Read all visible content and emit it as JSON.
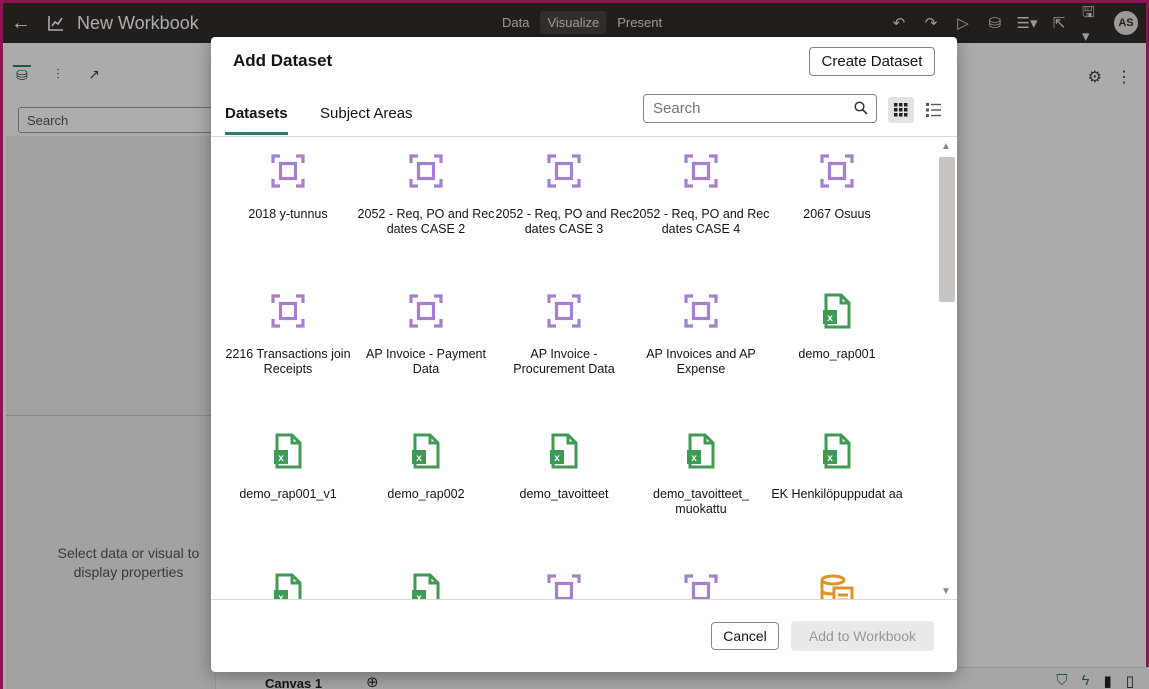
{
  "app": {
    "title": "New Workbook",
    "modes": [
      "Data",
      "Visualize",
      "Present"
    ],
    "active_mode": "Visualize",
    "user_initials": "AS",
    "left_search_placeholder": "Search",
    "properties_message": "Select data or visual to display properties",
    "canvas_tab": "Canvas 1",
    "add_canvas_symbol": "⊕",
    "brand_border_color": "#c6237d",
    "accent_color": "#2f7d6d"
  },
  "dialog": {
    "title": "Add Dataset",
    "create_button": "Create Dataset",
    "tabs": [
      {
        "label": "Datasets",
        "active": true
      },
      {
        "label": "Subject Areas",
        "active": false
      }
    ],
    "search_placeholder": "Search",
    "view_mode": "grid",
    "items": [
      {
        "label": "2018 y-tunnus",
        "icon": "subject-area-icon"
      },
      {
        "label": "2052 - Req, PO and Rec dates CASE 2",
        "icon": "subject-area-icon"
      },
      {
        "label": "2052 - Req, PO and Rec dates CASE 3",
        "icon": "subject-area-icon"
      },
      {
        "label": "2052 - Req, PO and Rec dates CASE 4",
        "icon": "subject-area-icon"
      },
      {
        "label": "2067 Osuus",
        "icon": "subject-area-icon"
      },
      {
        "label": "2216 Transactions join Receipts",
        "icon": "subject-area-icon"
      },
      {
        "label": "AP Invoice - Payment Data",
        "icon": "subject-area-icon"
      },
      {
        "label": "AP Invoice - Procurement Data",
        "icon": "subject-area-icon"
      },
      {
        "label": "AP Invoices and AP Expense",
        "icon": "subject-area-icon"
      },
      {
        "label": "demo_rap001",
        "icon": "excel-file-icon"
      },
      {
        "label": "demo_rap001_v1",
        "icon": "excel-file-icon"
      },
      {
        "label": "demo_rap002",
        "icon": "excel-file-icon"
      },
      {
        "label": "demo_tavoitteet",
        "icon": "excel-file-icon"
      },
      {
        "label": "demo_tavoitteet_ muokattu",
        "icon": "excel-file-icon"
      },
      {
        "label": "EK Henkilöpuppudat aa",
        "icon": "excel-file-icon"
      },
      {
        "label": "",
        "icon": "excel-file-icon"
      },
      {
        "label": "",
        "icon": "excel-file-icon"
      },
      {
        "label": "",
        "icon": "subject-area-icon"
      },
      {
        "label": "",
        "icon": "subject-area-icon"
      },
      {
        "label": "",
        "icon": "database-icon"
      }
    ],
    "cancel_button": "Cancel",
    "add_button": "Add to Workbook",
    "add_button_enabled": false
  }
}
